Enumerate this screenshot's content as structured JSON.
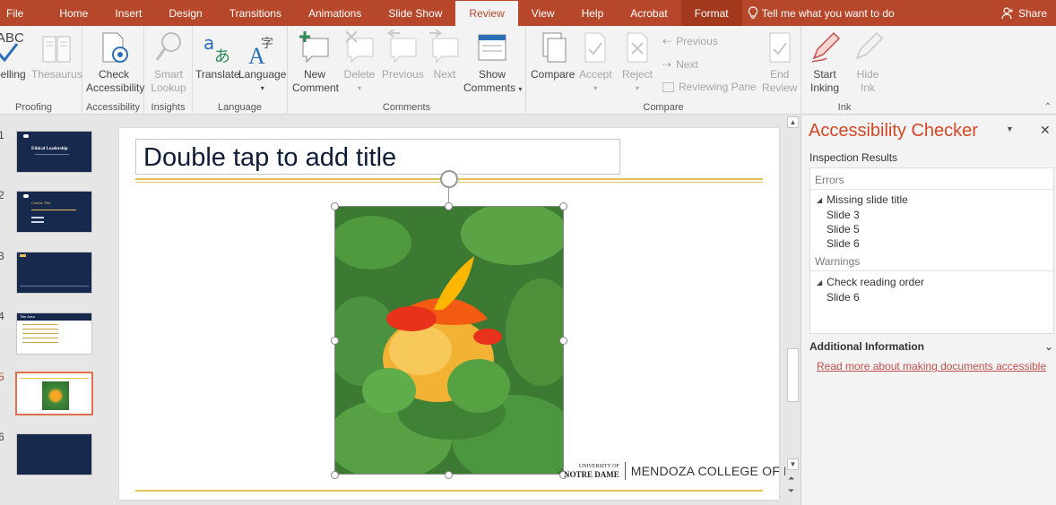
{
  "tabs": {
    "file": "File",
    "home": "Home",
    "insert": "Insert",
    "design": "Design",
    "transitions": "Transitions",
    "animations": "Animations",
    "slideshow": "Slide Show",
    "review": "Review",
    "view": "View",
    "help": "Help",
    "acrobat": "Acrobat",
    "format": "Format",
    "tellme": "Tell me what you want to do",
    "share": "Share"
  },
  "ribbon": {
    "spelling": "pelling",
    "thesaurus": "Thesaurus",
    "proofing": "Proofing",
    "check_accessibility_1": "Check",
    "check_accessibility_2": "Accessibility",
    "accessibility": "Accessibility",
    "smart_lookup_1": "Smart",
    "smart_lookup_2": "Lookup",
    "insights": "Insights",
    "translate": "Translate",
    "language_btn": "Language",
    "language": "Language",
    "new_comment_1": "New",
    "new_comment_2": "Comment",
    "delete": "Delete",
    "previous": "Previous",
    "next": "Next",
    "show_comments_1": "Show",
    "show_comments_2": "Comments",
    "comments": "Comments",
    "compare_btn": "Compare",
    "accept": "Accept",
    "reject": "Reject",
    "prev_small": "Previous",
    "next_small": "Next",
    "reviewing_pane": "Reviewing Pane",
    "end_review_1": "End",
    "end_review_2": "Review",
    "compare": "Compare",
    "start_inking_1": "Start",
    "start_inking_2": "Inking",
    "hide_ink_1": "Hide",
    "hide_ink_2": "Ink",
    "ink": "Ink"
  },
  "thumbnails": {
    "nums": [
      "1",
      "2",
      "3",
      "4",
      "5",
      "6"
    ],
    "t1_title": "Ethical Leadership",
    "t2_title": "Course Title",
    "t4_title": "Title Area"
  },
  "slide": {
    "title_placeholder": "Double tap to add title",
    "footer_university": "UNIVERSITY OF",
    "footer_notre": "NOTRE DAME",
    "footer_college": "MENDOZA COLLEGE OF BUSINESS"
  },
  "accessibility": {
    "title": "Accessibility Checker",
    "inspection_results": "Inspection Results",
    "errors_header": "Errors",
    "missing_title": "Missing slide title",
    "error_slides": [
      "Slide 3",
      "Slide 5",
      "Slide 6"
    ],
    "warnings_header": "Warnings",
    "reading_order": "Check reading order",
    "warning_slides": [
      "Slide 6"
    ],
    "additional_info": "Additional Information",
    "read_more": "Read more about making documents accessible"
  },
  "colors": {
    "accent": "#b7472a",
    "pane_title": "#d24726",
    "link": "#c0504d",
    "slide_navy": "#17294d",
    "gold": "#e6c35a"
  }
}
